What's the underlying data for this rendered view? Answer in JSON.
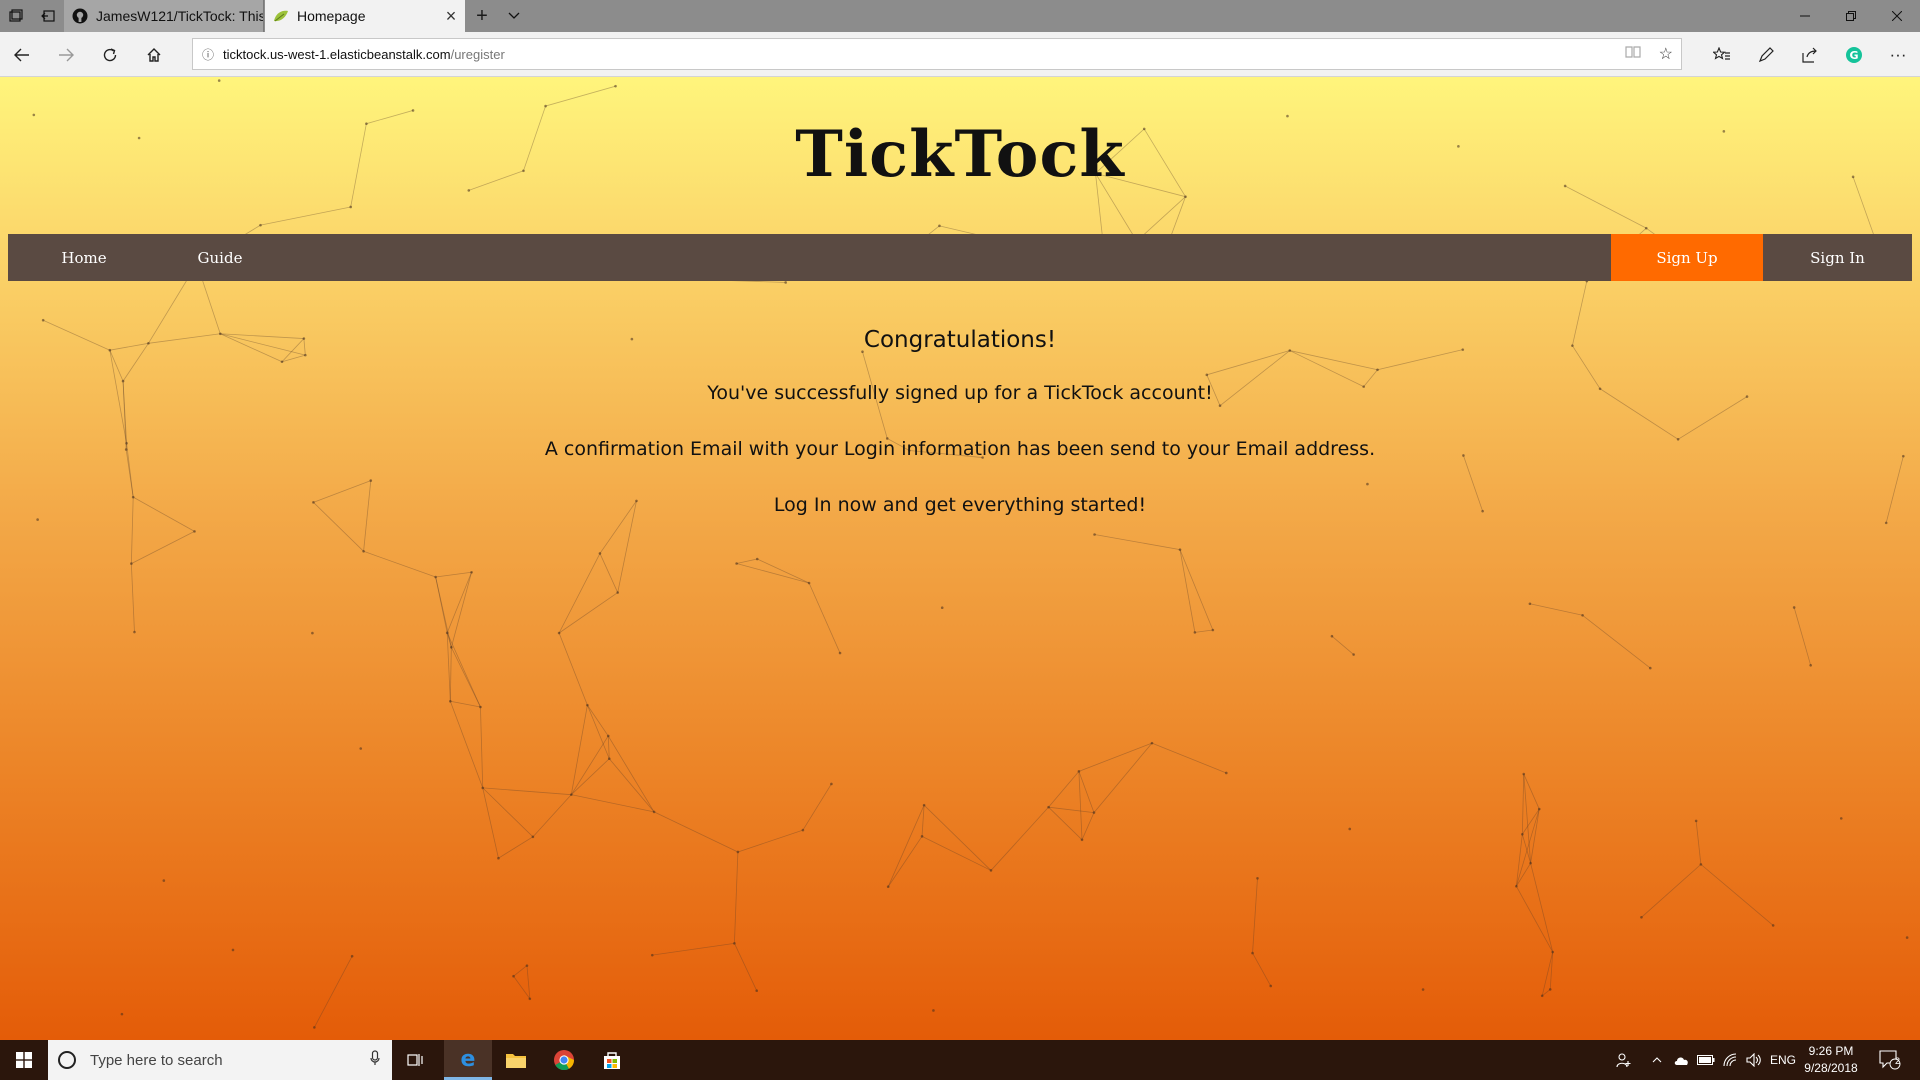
{
  "browser": {
    "tabs": [
      {
        "title": "JamesW121/TickTock: This i",
        "active": false,
        "icon": "github-icon"
      },
      {
        "title": "Homepage",
        "active": true,
        "icon": "leaf-icon"
      }
    ],
    "new_tab_icon": "plus-icon",
    "tab_list_icon": "chevron-down-icon",
    "address": {
      "host": "ticktock.us-west-1.elasticbeanstalk.com",
      "path": "/uregister"
    }
  },
  "site": {
    "title": "TickTock",
    "nav": {
      "home": "Home",
      "guide": "Guide",
      "signup": "Sign Up",
      "signin": "Sign In"
    },
    "message": {
      "heading": "Congratulations!",
      "line1": "You've successfully signed up for a TickTock account!",
      "line2": "A confirmation Email with your Login information has been send to your Email address.",
      "line3": "Log In now and get everything started!"
    }
  },
  "taskbar": {
    "search_placeholder": "Type here to search",
    "language": "ENG",
    "time": "9:26 PM",
    "date": "9/28/2018",
    "notification_count": "2"
  },
  "colors": {
    "nav_bg": "#5a4a42",
    "signup_accent": "#ff6a00",
    "gradient_top": "#fff57c",
    "gradient_bottom": "#e45c08"
  }
}
